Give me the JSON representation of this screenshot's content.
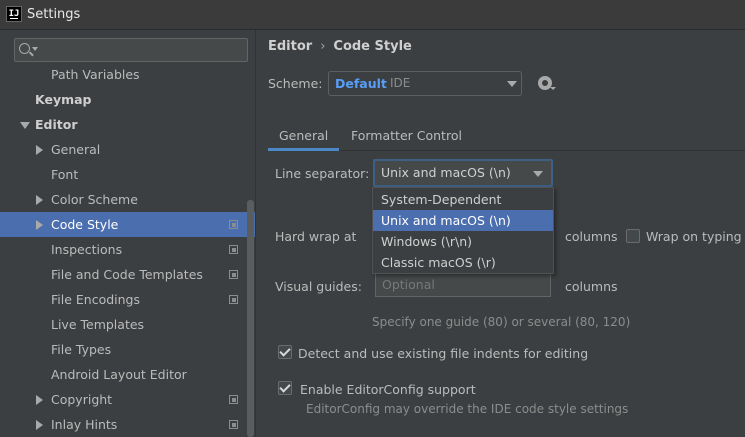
{
  "window": {
    "title": "Settings",
    "logo_text": "IJ"
  },
  "search": {
    "value": ""
  },
  "tree": [
    {
      "label": "Path Variables",
      "bold": false,
      "indent": 1,
      "arrow": "",
      "copy": false,
      "selected": false
    },
    {
      "label": "Keymap",
      "bold": true,
      "indent": 0,
      "arrow": "",
      "copy": false,
      "selected": false
    },
    {
      "label": "Editor",
      "bold": true,
      "indent": 0,
      "arrow": "open",
      "copy": false,
      "selected": false
    },
    {
      "label": "General",
      "bold": false,
      "indent": 1,
      "arrow": "closed",
      "copy": false,
      "selected": false
    },
    {
      "label": "Font",
      "bold": false,
      "indent": 1,
      "arrow": "",
      "copy": false,
      "selected": false
    },
    {
      "label": "Color Scheme",
      "bold": false,
      "indent": 1,
      "arrow": "closed",
      "copy": false,
      "selected": false
    },
    {
      "label": "Code Style",
      "bold": false,
      "indent": 1,
      "arrow": "closed",
      "copy": true,
      "selected": true
    },
    {
      "label": "Inspections",
      "bold": false,
      "indent": 1,
      "arrow": "",
      "copy": true,
      "selected": false
    },
    {
      "label": "File and Code Templates",
      "bold": false,
      "indent": 1,
      "arrow": "",
      "copy": true,
      "selected": false
    },
    {
      "label": "File Encodings",
      "bold": false,
      "indent": 1,
      "arrow": "",
      "copy": true,
      "selected": false
    },
    {
      "label": "Live Templates",
      "bold": false,
      "indent": 1,
      "arrow": "",
      "copy": false,
      "selected": false
    },
    {
      "label": "File Types",
      "bold": false,
      "indent": 1,
      "arrow": "",
      "copy": false,
      "selected": false
    },
    {
      "label": "Android Layout Editor",
      "bold": false,
      "indent": 1,
      "arrow": "",
      "copy": false,
      "selected": false
    },
    {
      "label": "Copyright",
      "bold": false,
      "indent": 1,
      "arrow": "closed",
      "copy": true,
      "selected": false
    },
    {
      "label": "Inlay Hints",
      "bold": false,
      "indent": 1,
      "arrow": "closed",
      "copy": true,
      "selected": false
    }
  ],
  "breadcrumb": {
    "parent": "Editor",
    "separator": "›",
    "current": "Code Style"
  },
  "scheme": {
    "label": "Scheme:",
    "name": "Default",
    "sub": "IDE"
  },
  "tabs": [
    "General",
    "Formatter Control"
  ],
  "line_separator": {
    "label": "Line separator:",
    "value": "Unix and macOS (\\n)",
    "options": [
      "System-Dependent",
      "Unix and macOS (\\n)",
      "Windows (\\r\\n)",
      "Classic macOS (\\r)"
    ],
    "selected_index": 1
  },
  "hard_wrap": {
    "label": "Hard wrap at",
    "unit": "columns",
    "wrap_on_typing": "Wrap on typing",
    "wrap_checked": false
  },
  "visual_guides": {
    "label": "Visual guides:",
    "placeholder": "Optional",
    "unit": "columns",
    "hint": "Specify one guide (80) or several (80, 120)"
  },
  "detect_indents": {
    "label": "Detect and use existing file indents for editing",
    "checked": true
  },
  "editorconfig": {
    "label": "Enable EditorConfig support",
    "checked": true,
    "hint": "EditorConfig may override the IDE code style settings"
  },
  "colors": {
    "selection": "#4b6eaf",
    "link_blue": "#589df6",
    "tab_underline": "#4a88c7"
  }
}
